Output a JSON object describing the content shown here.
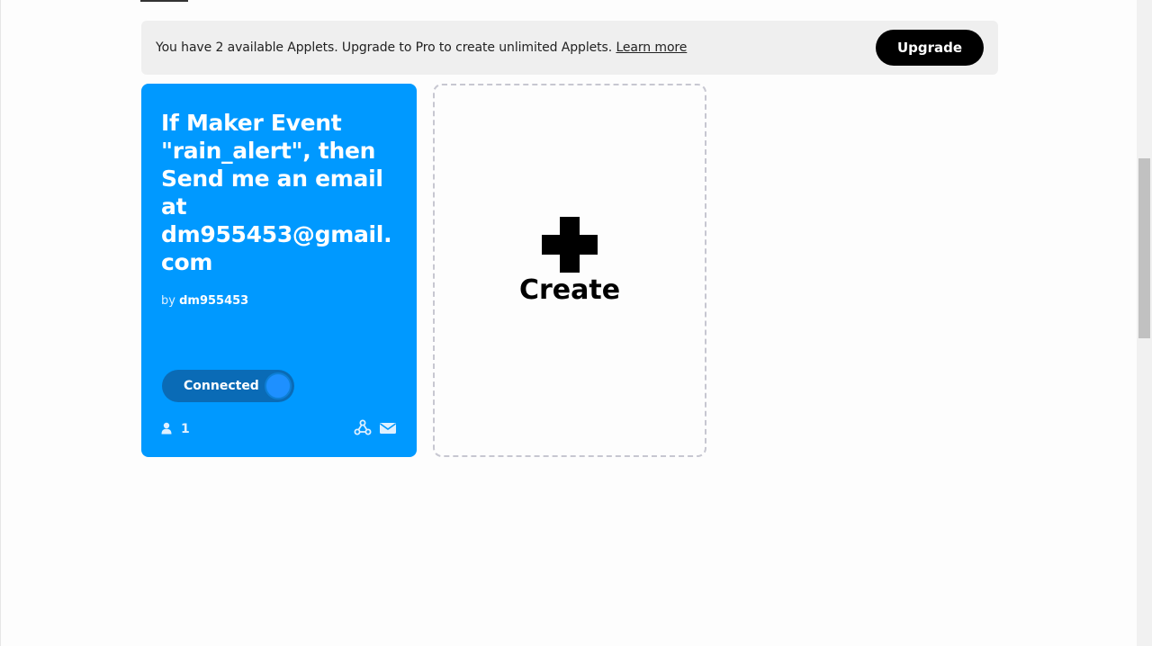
{
  "banner": {
    "message": "You have 2 available Applets. Upgrade to Pro to create unlimited Applets.",
    "link_label": "Learn more",
    "upgrade_label": "Upgrade"
  },
  "applet": {
    "title": "If Maker Event \"rain_alert\", then Send me an email at dm955453@gmail.com",
    "author_prefix": "by",
    "author": "dm955453",
    "status": "Connected",
    "users_count": "1",
    "color": "#0099ff",
    "icons": [
      "user-icon",
      "webhooks-icon",
      "email-icon"
    ]
  },
  "create_card": {
    "label": "Create",
    "icon": "plus-icon"
  }
}
